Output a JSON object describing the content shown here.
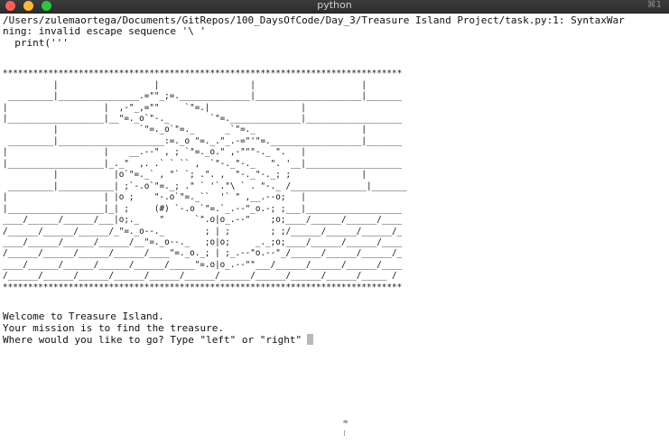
{
  "window": {
    "title": "python",
    "shortcut": "⌘1"
  },
  "terminal": {
    "warning_line1": "/Users/zulemaortega/Documents/GitRepos/100_DaysOfCode/Day_3/Treasure Island Project/task.py:1: SyntaxWar",
    "warning_line2": "ning: invalid escape sequence '\\ '",
    "warning_line3": "  print('''",
    "art": [
      "*******************************************************************************",
      "          |                   |                  |                     |",
      " _________|________________.=\"\"_;=.______________|_____________________|_______",
      "|                   |  ,-\"_,=\"\"     `\"=.|                  |",
      "|___________________|__\"=._o`\"-._        `\"=.______________|___________________",
      "          |                `\"=._o`\"=._      _`\"=._                     |",
      " _________|_____________________:=._o \"=._.\"_.-=\"'\"=.__________________|_______",
      "|                   |    __.--\" , ; `\"=._o.\" ,-\"\"\"-._ \".   |",
      "|___________________|_._\"  ,. .` ` `` ,  `\"-._\"-._   \". '__|___________________",
      "          |           |o`\"=._` , \"` `; .\". ,  \"-._\"-._; ;              |",
      " _________|___________| ;`-.o`\"=._; .\" ` '`.\"\\ ` . \"-._ /_______________|_______",
      "|                   | |o ;    \"-.o`\"=._``  '` \" ,__.--o;   |",
      "|___________________|_| ;     (#) `-.o `\"=.`_.--\"_o.-; ;___|___________________",
      "____/______/______/___|o;._    \"      `\".o|o_.--\"    ;o;____/______/______/____",
      "/______/______/______/_\"=._o--._        ; | ;        ; ;/______/______/______/_",
      "____/______/______/______/__\"=._o--._   ;o|o;     _._;o;____/______/______/____",
      "/______/______/______/______/____\"=._o._; | ;_.--\"o.--\"_/______/______/______/_",
      "____/______/______/______/______/_____\"=.o|o_.--\"\"___/______/______/______/____",
      "/______/______/______/______/______/______/______/______/______/______/_____ /",
      "*******************************************************************************"
    ],
    "welcome": "Welcome to Treasure Island.",
    "mission": "Your mission is to find the treasure.",
    "question": "Where would you like to go? Type \"left\" or \"right\""
  }
}
